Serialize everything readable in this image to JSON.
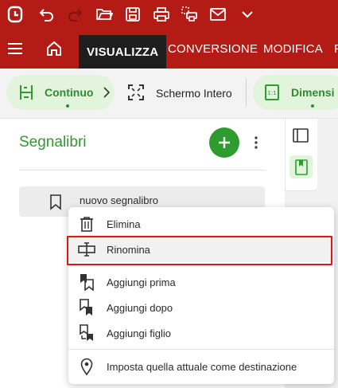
{
  "toolbar": {
    "continuous_label": "Continuo",
    "fullscreen_label": "Schermo Intero",
    "dimension_label": "Dimensi"
  },
  "tabs": [
    {
      "label": "VISUALIZZA"
    },
    {
      "label": "CONVERSIONE"
    },
    {
      "label": "MODIFICA"
    },
    {
      "label": "F"
    }
  ],
  "bookmarks": {
    "title": "Segnalibri",
    "items": [
      {
        "label": "nuovo segnalibro"
      }
    ]
  },
  "context_menu": {
    "items": [
      {
        "label": "Elimina",
        "icon": "trash-icon"
      },
      {
        "label": "Rinomina",
        "icon": "rename-icon"
      },
      {
        "label": "Aggiungi prima",
        "icon": "bookmark-add-before-icon"
      },
      {
        "label": "Aggiungi dopo",
        "icon": "bookmark-add-after-icon"
      },
      {
        "label": "Aggiungi figlio",
        "icon": "bookmark-add-child-icon"
      },
      {
        "label": "Imposta quella attuale come destinazione",
        "icon": "location-pin-icon"
      }
    ]
  },
  "colors": {
    "brand_red": "#b31b14",
    "accent_green": "#2e9b2e",
    "pill_green": "#e3f4dd",
    "highlight_red": "#e1161c"
  }
}
